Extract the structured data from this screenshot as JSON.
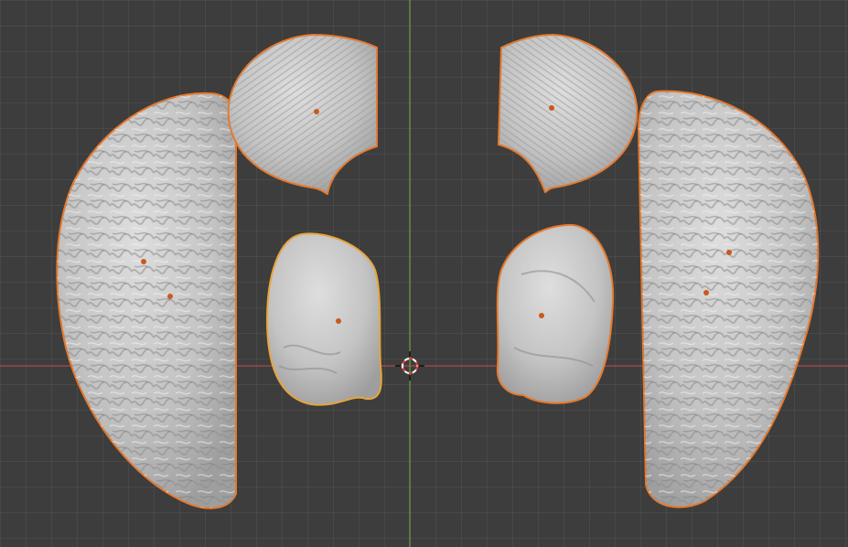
{
  "viewport": {
    "mode": "top-orthographic",
    "grid": true,
    "colors": {
      "background": "#3d3d3d",
      "grid_line": "#484848",
      "x_axis": "#b04a4a",
      "y_axis": "#6f9a3a",
      "selection_outline": "#e8782a",
      "origin_dot": "#c85a1e",
      "mesh_fill": "#c9c9c9"
    },
    "cursor_icon": "3d-cursor-icon",
    "objects": [
      {
        "name": "left-cerebral-hemisphere",
        "selected": true
      },
      {
        "name": "left-cerebellum-half",
        "selected": true
      },
      {
        "name": "left-brainstem-segment",
        "selected": true
      },
      {
        "name": "right-cerebellum-half",
        "selected": true
      },
      {
        "name": "right-brainstem-segment",
        "selected": true
      },
      {
        "name": "right-cerebral-hemisphere",
        "selected": true
      }
    ]
  }
}
